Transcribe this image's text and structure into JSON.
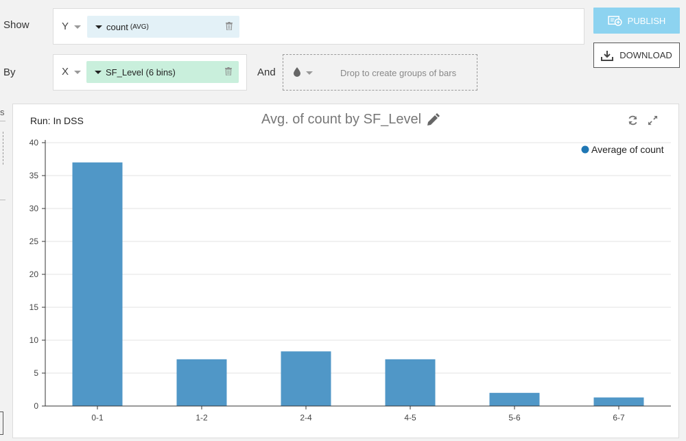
{
  "controls": {
    "show_label": "Show",
    "by_label": "By",
    "and_label": "And",
    "y_axis_letter": "Y",
    "x_axis_letter": "X",
    "y_measure": {
      "name": "count",
      "agg": "(AVG)"
    },
    "x_dimension": {
      "name": "SF_Level (6 bins)"
    },
    "group_drop_placeholder": "Drop to create groups of bars",
    "left_fragment_text": "s"
  },
  "buttons": {
    "publish_label": "PUBLISH",
    "download_label": "DOWNLOAD"
  },
  "chart_header": {
    "run_label": "Run: In DSS",
    "title": "Avg. of count by SF_Level"
  },
  "colors": {
    "bar": "#5097c7",
    "legend_dot": "#1f77b4",
    "y_pill": "#e3f1f7",
    "x_pill": "#c9efdc",
    "publish": "#8dd3f0"
  },
  "icons": [
    "caret-down-icon",
    "trash-icon",
    "droplet-icon",
    "publish-icon",
    "download-icon",
    "pencil-icon",
    "refresh-icon",
    "expand-icon"
  ],
  "chart_data": {
    "type": "bar",
    "title": "Avg. of count by SF_Level",
    "categories": [
      "0-1",
      "1-2",
      "2-4",
      "4-5",
      "5-6",
      "6-7"
    ],
    "series": [
      {
        "name": "Average of count",
        "values": [
          37,
          7.1,
          8.3,
          7.1,
          2.0,
          1.3
        ]
      }
    ],
    "xlabel": "",
    "ylabel": "",
    "ylim": [
      0,
      40
    ],
    "yticks": [
      0,
      5,
      10,
      15,
      20,
      25,
      30,
      35,
      40
    ],
    "grid": true,
    "legend": "top-right"
  }
}
